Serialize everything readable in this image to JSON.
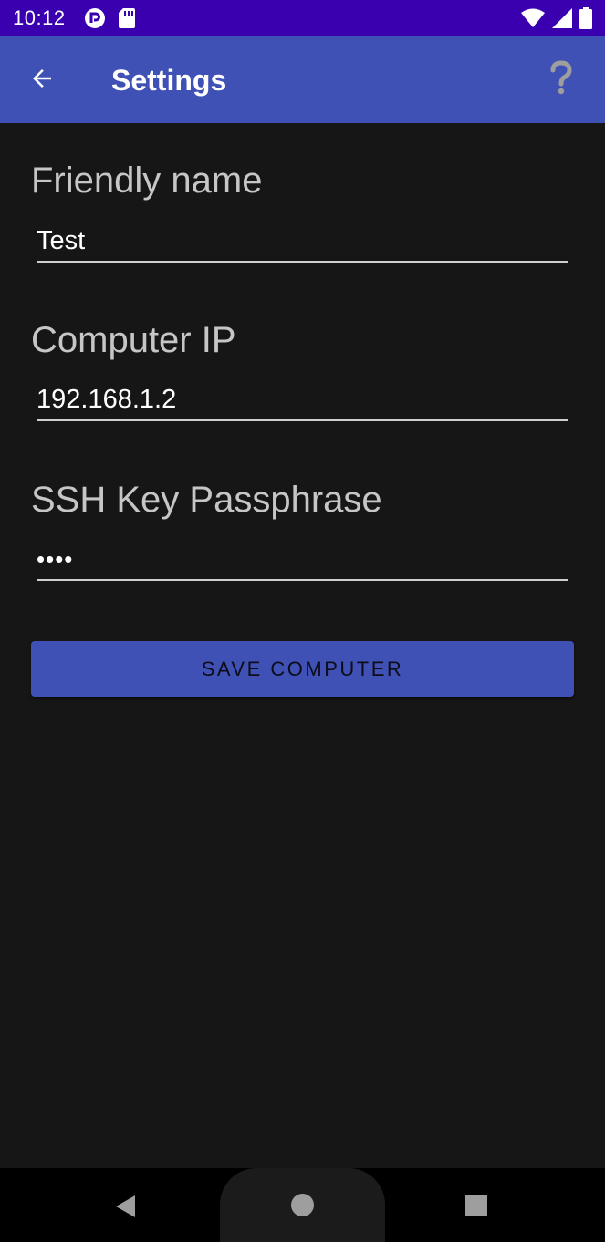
{
  "status_bar": {
    "time": "10:12",
    "background": "#3a00b0",
    "left_icons": [
      "app-notification-icon",
      "sd-card-icon"
    ],
    "right_icons": [
      "wifi-icon",
      "cell-signal-icon",
      "battery-icon"
    ]
  },
  "app_bar": {
    "title": "Settings",
    "background": "#3f51b5",
    "back_icon": "arrow-back-icon",
    "help_icon": "help-icon"
  },
  "form": {
    "friendly_name": {
      "label": "Friendly name",
      "value": "Test"
    },
    "computer_ip": {
      "label": "Computer IP",
      "value": "192.168.1.2"
    },
    "ssh_passphrase": {
      "label": "SSH Key Passphrase",
      "value": "••••"
    },
    "save_button_label": "SAVE COMPUTER"
  },
  "nav_bar": {
    "back_icon": "nav-back-icon",
    "home_icon": "nav-home-icon",
    "recents_icon": "nav-recents-icon"
  },
  "colors": {
    "accent": "#3f51b5",
    "background": "#161616"
  }
}
